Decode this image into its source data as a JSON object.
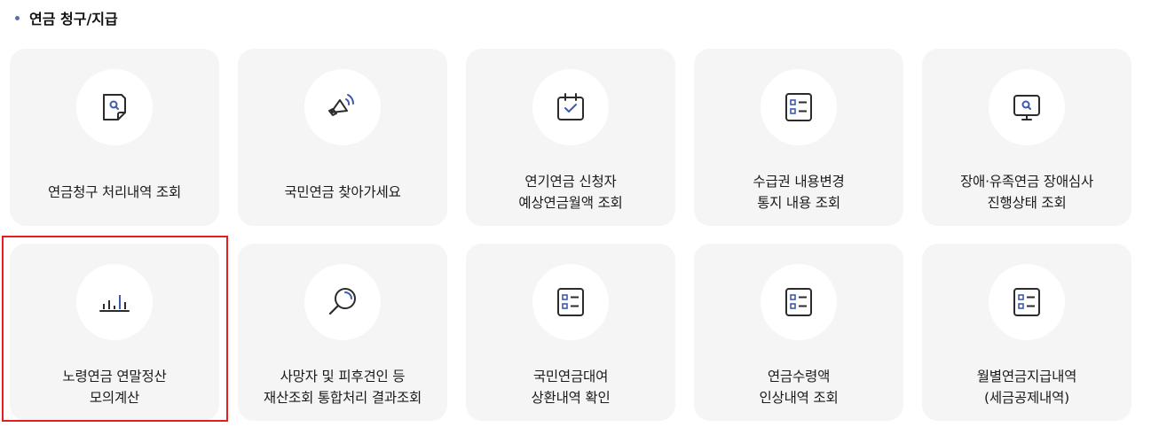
{
  "section": {
    "title": "연금 청구/지급"
  },
  "colors": {
    "card_bg": "#f5f5f5",
    "icon_stroke": "#2b2b2b",
    "icon_accent": "#3d5ab0",
    "highlight": "#e02020"
  },
  "cards": [
    {
      "lines": [
        "연금청구 처리내역 조회"
      ],
      "icon": "document-search-icon"
    },
    {
      "lines": [
        "국민연금 찾아가세요"
      ],
      "icon": "megaphone-icon"
    },
    {
      "lines": [
        "연기연금 신청자",
        "예상연금월액 조회"
      ],
      "icon": "calendar-check-icon"
    },
    {
      "lines": [
        "수급권 내용변경",
        "통지 내용 조회"
      ],
      "icon": "checklist-icon"
    },
    {
      "lines": [
        "장애·유족연금 장애심사",
        "진행상태 조회"
      ],
      "icon": "monitor-search-icon"
    },
    {
      "lines": [
        "노령연금 연말정산",
        "모의계산"
      ],
      "icon": "bar-chart-icon"
    },
    {
      "lines": [
        "사망자 및 피후견인 등",
        "재산조회 통합처리 결과조회"
      ],
      "icon": "magnifier-icon"
    },
    {
      "lines": [
        "국민연금대여",
        "상환내역 확인"
      ],
      "icon": "checklist-icon"
    },
    {
      "lines": [
        "연금수령액",
        "인상내역 조회"
      ],
      "icon": "checklist-icon"
    },
    {
      "lines": [
        "월별연금지급내역",
        "(세금공제내역)"
      ],
      "icon": "checklist-icon"
    }
  ]
}
